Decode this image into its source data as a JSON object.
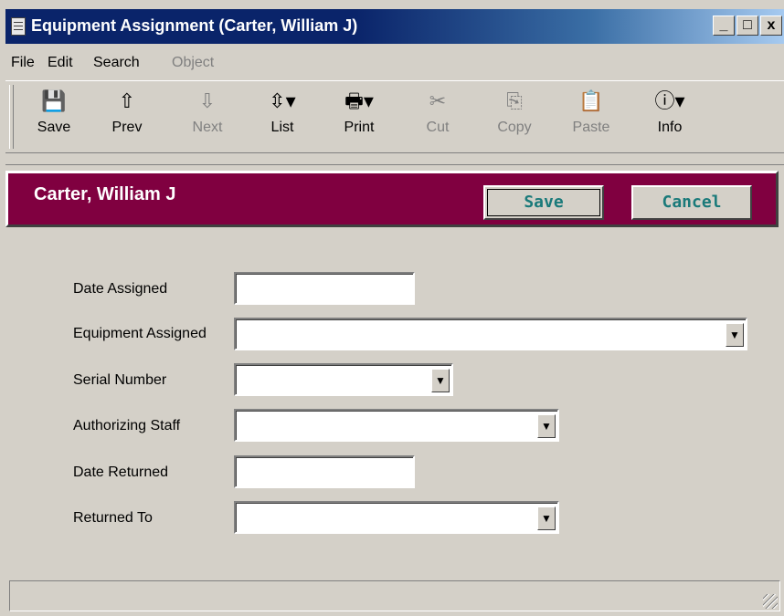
{
  "window": {
    "title": "Equipment Assignment (Carter, William J)",
    "minimize_label": "_",
    "maximize_label": "□",
    "close_label": "x"
  },
  "menu": {
    "file": "File",
    "edit": "Edit",
    "search": "Search",
    "object": "Object"
  },
  "toolbar": {
    "save": {
      "label": "Save",
      "icon": "💾"
    },
    "prev": {
      "label": "Prev",
      "icon": "⇧"
    },
    "next": {
      "label": "Next",
      "icon": "⇩"
    },
    "list": {
      "label": "List",
      "icon": "⇳▾"
    },
    "print": {
      "label": "Print",
      "icon": "🖶▾"
    },
    "cut": {
      "label": "Cut",
      "icon": "✂"
    },
    "copy": {
      "label": "Copy",
      "icon": "⎘"
    },
    "paste": {
      "label": "Paste",
      "icon": "📋"
    },
    "info": {
      "label": "Info",
      "icon": "ⓘ▾"
    }
  },
  "header": {
    "name": "Carter, William J",
    "save_label": "Save",
    "cancel_label": "Cancel"
  },
  "form": {
    "date_assigned_label": "Date Assigned",
    "date_assigned_value": "",
    "equipment_assigned_label": "Equipment Assigned",
    "equipment_assigned_value": "",
    "serial_number_label": "Serial Number",
    "serial_number_value": "",
    "authorizing_staff_label": "Authorizing Staff",
    "authorizing_staff_value": "",
    "date_returned_label": "Date Returned",
    "date_returned_value": "",
    "returned_to_label": "Returned To",
    "returned_to_value": ""
  },
  "statusbar": {
    "text": ""
  },
  "colors": {
    "header_band": "#800040",
    "title_bar": "#0a246a",
    "button_text": "#1a7a7a",
    "face": "#d4d0c8"
  }
}
